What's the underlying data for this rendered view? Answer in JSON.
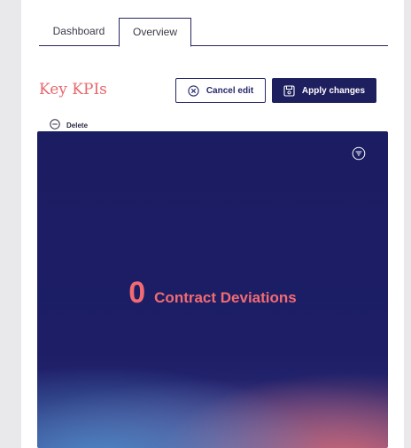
{
  "tabs": [
    {
      "label": "Dashboard",
      "active": false
    },
    {
      "label": "Overview",
      "active": true
    }
  ],
  "section": {
    "title": "Key KPIs"
  },
  "actions": {
    "cancel_label": "Cancel edit",
    "apply_label": "Apply changes"
  },
  "widget_controls": {
    "delete_label": "Delete"
  },
  "kpi": {
    "value": "0",
    "label": "Contract Deviations"
  },
  "icons": {
    "cancel": "close-circle-icon",
    "apply": "save-icon",
    "delete": "minus-circle-icon",
    "filter": "filter-icon"
  },
  "colors": {
    "accent_red": "#e8676c",
    "navy": "#1e1f5e",
    "card_bg": "#1b1c62",
    "kpi_text": "#f26b72"
  }
}
